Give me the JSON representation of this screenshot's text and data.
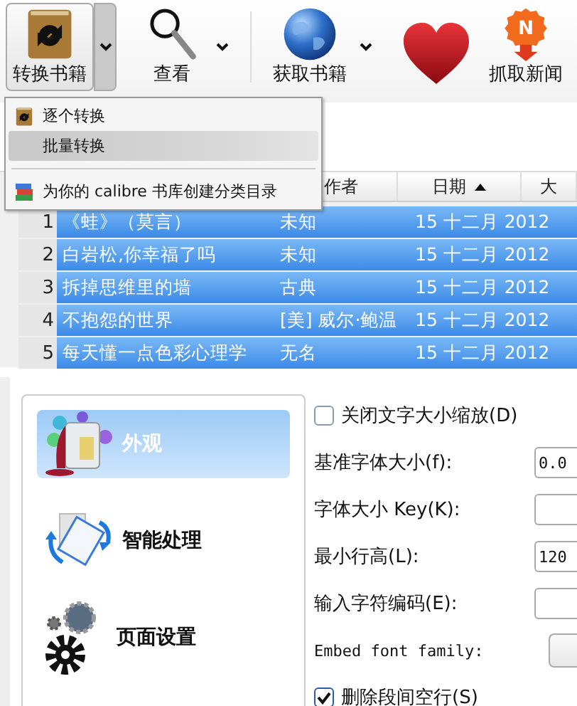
{
  "toolbar": [
    {
      "kind": "convert",
      "label": "转换书籍",
      "dropdown": true,
      "pressed": true
    },
    {
      "kind": "view",
      "label": "查看",
      "dropdown": true,
      "pressed": false
    },
    {
      "kind": "globe",
      "label": "获取书籍",
      "dropdown": true,
      "pressed": false
    },
    {
      "kind": "heart",
      "dropdown": false,
      "pressed": false
    },
    {
      "kind": "news",
      "label": "抓取新闻",
      "icon_text": "N",
      "dropdown": false,
      "pressed": false
    }
  ],
  "menu": [
    {
      "kind": "convert",
      "label": "逐个转换",
      "selected": false
    },
    {
      "kind": "plain",
      "label": "批量转换",
      "selected": true
    },
    {
      "kind": "separator"
    },
    {
      "kind": "catalog",
      "label": "为你的 calibre 书库创建分类目录",
      "selected": false
    }
  ],
  "table": {
    "columns": [
      {
        "label": "作者",
        "sorted": false
      },
      {
        "label": "日期",
        "sorted": true
      },
      {
        "label": "大",
        "sorted": false
      }
    ],
    "rows": [
      {
        "number": "1",
        "title": "《蛙》（莫言）",
        "author": "未知",
        "date": "15 十二月 2012",
        "selected": true
      },
      {
        "number": "2",
        "title": "白岩松,你幸福了吗",
        "author": "未知",
        "date": "15 十二月 2012",
        "selected": true
      },
      {
        "number": "3",
        "title": "拆掉思维里的墙",
        "author": "古典",
        "date": "15 十二月 2012",
        "selected": true
      },
      {
        "number": "4",
        "title": "不抱怨的世界",
        "author": "[美] 威尔·鲍温",
        "date": "15 十二月 2012",
        "selected": true
      },
      {
        "number": "5",
        "title": "每天懂一点色彩心理学",
        "author": "无名",
        "date": "15 十二月 2012",
        "selected": true
      }
    ]
  },
  "settings": {
    "sidebar": [
      {
        "kind": "appearance",
        "label": "外观",
        "selected": true
      },
      {
        "kind": "heuristics",
        "label": "智能处理",
        "selected": false
      },
      {
        "kind": "page",
        "label": "页面设置",
        "selected": false
      }
    ],
    "options": [
      {
        "kind": "checkbox",
        "label": "关闭文字大小缩放(D)",
        "checked": false
      },
      {
        "kind": "field",
        "label": "基准字体大小(f):",
        "value": "0.0"
      },
      {
        "kind": "field",
        "label": "字体大小 Key(K):"
      },
      {
        "kind": "field",
        "label": "最小行高(L):",
        "value": "120"
      },
      {
        "kind": "field",
        "label": "输入字符编码(E):"
      },
      {
        "kind": "combo",
        "label": "Embed font family:"
      },
      {
        "kind": "checkbox",
        "label": "删除段间空行(S)",
        "checked": true
      }
    ]
  }
}
